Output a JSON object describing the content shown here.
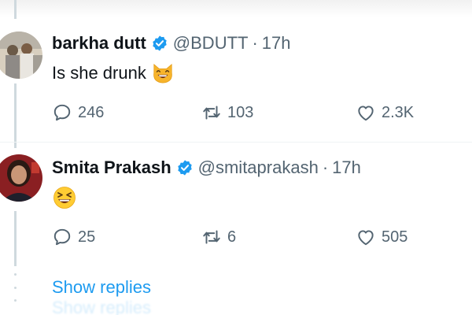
{
  "tweets": [
    {
      "name": "barkha dutt",
      "handle": "@BDUTT",
      "separator": "·",
      "time": "17h",
      "text": "Is she drunk",
      "emoji": "grinning-cat-with-smiling-eyes",
      "verified": true,
      "replies": "246",
      "retweets": "103",
      "likes": "2.3K"
    },
    {
      "name": "Smita Prakash",
      "handle": "@smitaprakash",
      "separator": "·",
      "time": "17h",
      "text": "",
      "emoji": "grinning-squinting-face",
      "verified": true,
      "replies": "25",
      "retweets": "6",
      "likes": "505"
    }
  ],
  "show_replies_label": "Show replies",
  "icons": {
    "verified": "verified-badge-icon",
    "reply": "reply-icon",
    "retweet": "retweet-icon",
    "like": "heart-icon"
  },
  "colors": {
    "accent": "#1d9bf0",
    "muted_text": "#536471",
    "primary_text": "#0f1419",
    "thread_line": "#cfd9de"
  }
}
